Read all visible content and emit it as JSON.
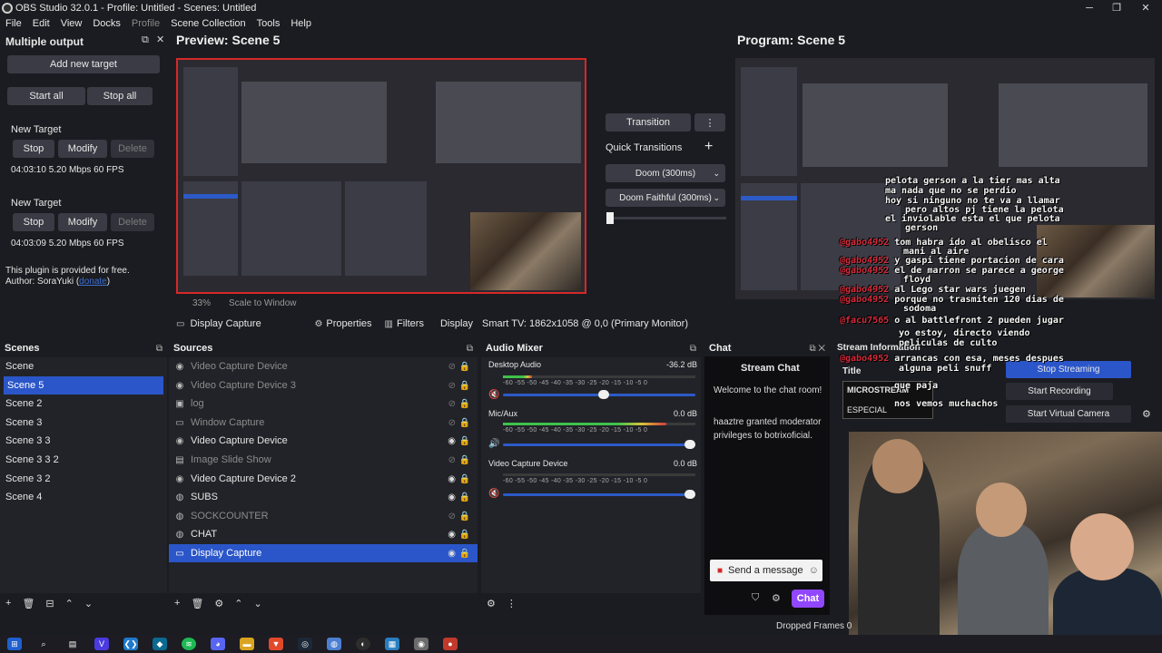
{
  "window": {
    "title": "OBS Studio 32.0.1 - Profile: Untitled - Scenes: Untitled",
    "minimize": "─",
    "maximize": "❐",
    "close": "✕"
  },
  "menu": [
    "File",
    "Edit",
    "View",
    "Docks",
    "Profile",
    "Scene Collection",
    "Tools",
    "Help"
  ],
  "multiple_output": {
    "title": "Multiple output",
    "add_target": "Add new target",
    "start_all": "Start all",
    "stop_all": "Stop all",
    "targets": [
      {
        "name": "New Target",
        "stop": "Stop",
        "modify": "Modify",
        "delete": "Delete",
        "stats": "04:03:10 5.20 Mbps 60 FPS"
      },
      {
        "name": "New Target",
        "stop": "Stop",
        "modify": "Modify",
        "delete": "Delete",
        "stats": "04:03:09 5.20 Mbps 60 FPS"
      }
    ],
    "free_note": "This plugin is provided for free.",
    "author_prefix": "Author: SoraYuki (",
    "author_link": "donate",
    "author_suffix": ")"
  },
  "preview": {
    "title": "Preview: Scene 5",
    "zoom": "33%",
    "scale_mode": "Scale to Window"
  },
  "program": {
    "title": "Program: Scene 5"
  },
  "transitions": {
    "transition_button": "Transition",
    "quick_label": "Quick Transitions",
    "add": "+",
    "option1": "Doom (300ms)",
    "option2": "Doom Faithful (300ms)"
  },
  "source_toolbar": {
    "source_name": "Display Capture",
    "properties": "Properties",
    "filters": "Filters",
    "display_label": "Display",
    "display_value": "Smart TV: 1862x1058 @ 0,0 (Primary Monitor)"
  },
  "scenes": {
    "title": "Scenes",
    "items": [
      "Scene",
      "Scene 5",
      "Scene 2",
      "Scene 3",
      "Scene 3 3",
      "Scene 3 3 2",
      "Scene 3 2",
      "Scene 4"
    ],
    "selected": "Scene 5"
  },
  "sources": {
    "title": "Sources",
    "items": [
      {
        "name": "Video Capture Device",
        "visible": false
      },
      {
        "name": "Video Capture Device 3",
        "visible": false
      },
      {
        "name": "log",
        "visible": false
      },
      {
        "name": "Window Capture",
        "visible": false
      },
      {
        "name": "Video Capture Device",
        "visible": true
      },
      {
        "name": "Image Slide Show",
        "visible": false
      },
      {
        "name": "Video Capture Device 2",
        "visible": true
      },
      {
        "name": "SUBS",
        "visible": true
      },
      {
        "name": "SOCKCOUNTER",
        "visible": false
      },
      {
        "name": "CHAT",
        "visible": true
      },
      {
        "name": "Display Capture",
        "visible": true
      }
    ],
    "selected": "Display Capture"
  },
  "audio_mixer": {
    "title": "Audio Mixer",
    "ticks": "-60  -55  -50  -45  -40  -35  -30  -25  -20  -15  -10   -5    0",
    "channels": [
      {
        "name": "Desktop Audio",
        "db": "-36.2 dB",
        "level": 0.15,
        "volume": 0.55
      },
      {
        "name": "Mic/Aux",
        "db": "0.0 dB",
        "level": 0.85,
        "volume": 1.0
      },
      {
        "name": "Video Capture Device",
        "db": "0.0 dB",
        "level": 0.0,
        "volume": 1.0
      }
    ]
  },
  "chat": {
    "title": "Chat",
    "header": "Stream Chat",
    "welcome": "Welcome to the chat room!",
    "moderator_note": "haaztre granted moderator privileges to botrixoficial.",
    "send_placeholder": "Send a message",
    "chat_button": "Chat"
  },
  "stream_information": {
    "title": "Stream Information",
    "title_label": "Title",
    "title_lines": [
      "MICROSTREAM",
      "ESPECIAL"
    ],
    "stop_streaming": "Stop Streaming",
    "start_recording": "Start Recording",
    "start_virtual_camera": "Start Virtual Camera"
  },
  "overlay_chat": [
    {
      "user": "",
      "text": "pelota gerson a la tier mas alta"
    },
    {
      "user": "",
      "text": "ma nada que no se perdio"
    },
    {
      "user": "",
      "text": "hoy si ninguno no te va a llamar"
    },
    {
      "user": "",
      "text": "pero altos pj tiene la pelota"
    },
    {
      "user": "",
      "text": "el inviolable esta el que pelota"
    },
    {
      "user": "",
      "text": "gerson"
    },
    {
      "user": "@gabo4952",
      "text": "tom habra ido al obelisco el"
    },
    {
      "user": "",
      "text": "mani al aire"
    },
    {
      "user": "@gabo4952",
      "text": "y gaspi tiene portacion de cara"
    },
    {
      "user": "@gabo4952",
      "text": "el de marron se parece a george"
    },
    {
      "user": "",
      "text": "floyd"
    },
    {
      "user": "@gabo4952",
      "text": "al Lego star wars juegen"
    },
    {
      "user": "@gabo4952",
      "text": "porque no trasmiten 120 dias de"
    },
    {
      "user": "",
      "text": "sodoma"
    },
    {
      "user": "@facu7565",
      "text": "o al battlefront 2 pueden jugar"
    },
    {
      "user": "",
      "text": "yo estoy, directo viendo"
    },
    {
      "user": "",
      "text": "peliculas de culto"
    },
    {
      "user": "@gabo4952",
      "text": "arrancas con esa, meses despues"
    },
    {
      "user": "",
      "text": "alguna peli snuff"
    },
    {
      "user": "",
      "text": "que paja"
    },
    {
      "user": "",
      "text": "nos vemos muchachos"
    }
  ],
  "status": {
    "dropped_frames": "Dropped Frames 0"
  },
  "colors": {
    "accent": "#2b56c9",
    "record_red": "#d62828",
    "twitch_purple": "#9147ff"
  }
}
